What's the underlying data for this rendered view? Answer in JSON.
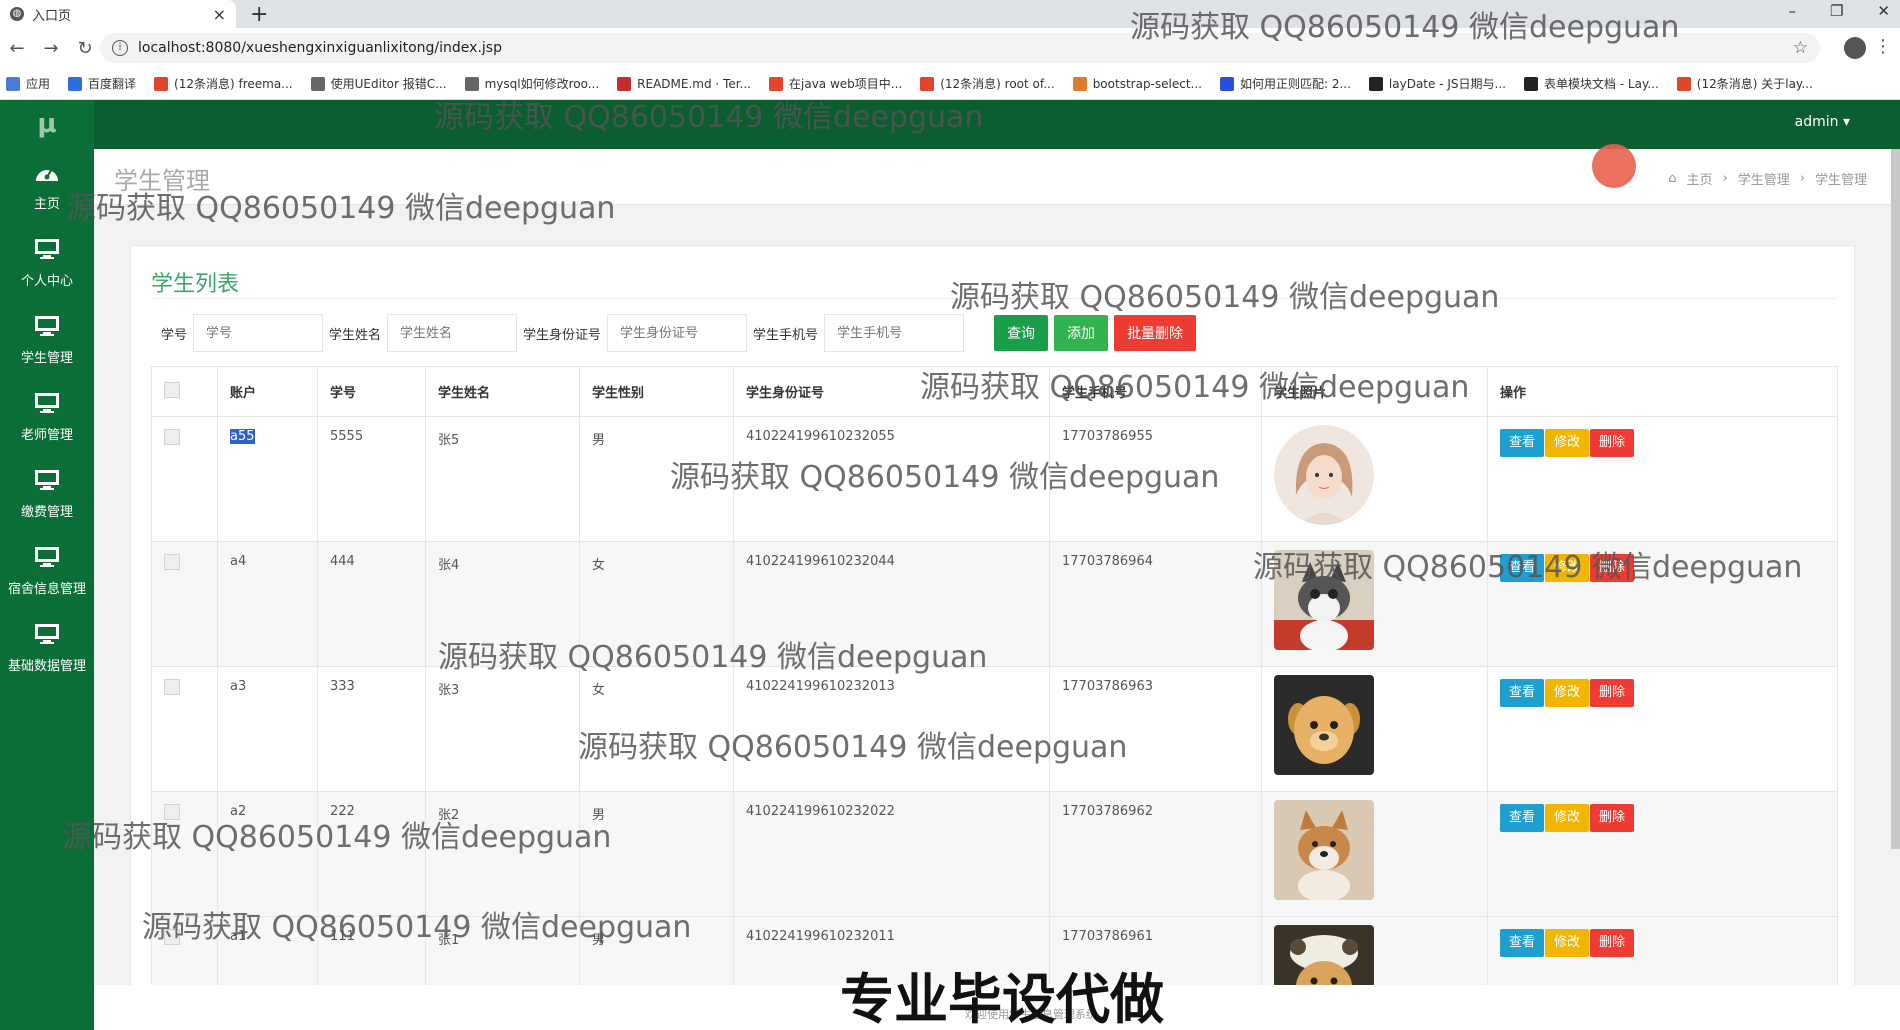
{
  "browser": {
    "tab_title": "入口页",
    "url": "localhost:8080/xueshengxinxiguanlixitong/index.jsp",
    "bookmarks": [
      {
        "label": "应用",
        "color": "#4a7bd8"
      },
      {
        "label": "百度翻译",
        "color": "#2a6ee0"
      },
      {
        "label": "(12条消息) freema...",
        "color": "#e0462c"
      },
      {
        "label": "使用UEditor 报错C...",
        "color": "#666666"
      },
      {
        "label": "mysql如何修改roo...",
        "color": "#666666"
      },
      {
        "label": "README.md · Ter...",
        "color": "#c32d2d"
      },
      {
        "label": "在java web项目中...",
        "color": "#e0462c"
      },
      {
        "label": "(12条消息) root of...",
        "color": "#e0462c"
      },
      {
        "label": "bootstrap-select...",
        "color": "#e07a2c"
      },
      {
        "label": "如何用正则匹配: 2...",
        "color": "#2a4fe0"
      },
      {
        "label": "layDate - JS日期与...",
        "color": "#222222"
      },
      {
        "label": "表单模块文档 - Lay...",
        "color": "#222222"
      },
      {
        "label": "(12条消息) 关于lay...",
        "color": "#e0462c"
      }
    ]
  },
  "sidebar": {
    "logo": "μ",
    "items": [
      {
        "label": "主页",
        "icon": "dashboard-icon"
      },
      {
        "label": "个人中心",
        "icon": "monitor-icon"
      },
      {
        "label": "学生管理",
        "icon": "monitor-icon"
      },
      {
        "label": "老师管理",
        "icon": "monitor-icon"
      },
      {
        "label": "缴费管理",
        "icon": "monitor-icon"
      },
      {
        "label": "宿舍信息管理",
        "icon": "monitor-icon"
      },
      {
        "label": "基础数据管理",
        "icon": "monitor-icon"
      }
    ]
  },
  "header": {
    "user": "admin ▾"
  },
  "page": {
    "title": "学生管理",
    "breadcrumb": [
      "主页",
      "学生管理",
      "学生管理"
    ]
  },
  "panel": {
    "title": "学生列表",
    "search": {
      "fields": [
        {
          "label": "学号",
          "placeholder": "学号"
        },
        {
          "label": "学生姓名",
          "placeholder": "学生姓名"
        },
        {
          "label": "学生身份证号",
          "placeholder": "学生身份证号"
        },
        {
          "label": "学生手机号",
          "placeholder": "学生手机号"
        }
      ],
      "query_btn": "查询",
      "add_btn": "添加",
      "batch_delete_btn": "批量删除"
    },
    "table": {
      "headers": [
        "账户",
        "学号",
        "学生姓名",
        "学生性别",
        "学生身份证号",
        "学生手机号",
        "学生照片",
        "操作"
      ],
      "actions": {
        "view": "查看",
        "edit": "修改",
        "delete": "删除"
      },
      "rows": [
        {
          "account": "a55",
          "no": "5555",
          "name": "张5",
          "gender": "男",
          "id_card": "410224199610232055",
          "phone": "17703786955",
          "photo": "girl-avatar"
        },
        {
          "account": "a4",
          "no": "444",
          "name": "张4",
          "gender": "女",
          "id_card": "410224199610232044",
          "phone": "17703786964",
          "photo": "cat-photo"
        },
        {
          "account": "a3",
          "no": "333",
          "name": "张3",
          "gender": "女",
          "id_card": "410224199610232013",
          "phone": "17703786963",
          "photo": "puppy-photo"
        },
        {
          "account": "a2",
          "no": "222",
          "name": "张2",
          "gender": "男",
          "id_card": "410224199610232022",
          "phone": "17703786962",
          "photo": "shiba-photo"
        },
        {
          "account": "a1",
          "no": "111",
          "name": "张1",
          "gender": "男",
          "id_card": "410224199610232011",
          "phone": "17703786961",
          "photo": "hat-dog-photo"
        }
      ]
    }
  },
  "overlay": {
    "watermark": "源码获取 QQ86050149 微信deepguan",
    "banner": "专业毕设代做",
    "footnote": "欢迎使用学生信息管理系统"
  }
}
